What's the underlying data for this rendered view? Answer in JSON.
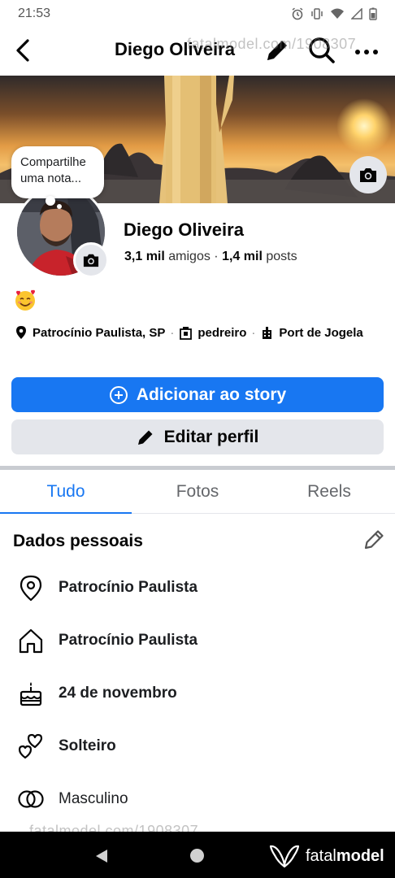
{
  "status_bar": {
    "time": "21:53"
  },
  "nav": {
    "title": "Diego Oliveira"
  },
  "watermark": {
    "text": "fatalmodel.com/1908307"
  },
  "note": {
    "text": "Compartilhe uma nota..."
  },
  "profile": {
    "name": "Diego Oliveira",
    "friends_count": "3,1 mil",
    "friends_label": "amigos",
    "separator": "·",
    "posts_count": "1,4 mil",
    "posts_label": "posts",
    "emoji": "🥰"
  },
  "details": {
    "location": "Patrocínio Paulista, SP",
    "job": "pedreiro",
    "workplace": "Port de Jogela"
  },
  "buttons": {
    "add_story": "Adicionar ao story",
    "edit_profile": "Editar perfil"
  },
  "tabs": [
    {
      "label": "Tudo",
      "active": true
    },
    {
      "label": "Fotos",
      "active": false
    },
    {
      "label": "Reels",
      "active": false
    }
  ],
  "personal": {
    "title": "Dados pessoais",
    "items": [
      {
        "icon": "location-pin-icon",
        "text": "Patrocínio Paulista"
      },
      {
        "icon": "home-icon",
        "text": "Patrocínio Paulista"
      },
      {
        "icon": "birthday-cake-icon",
        "text": "24 de novembro"
      },
      {
        "icon": "hearts-icon",
        "text": "Solteiro"
      },
      {
        "icon": "gender-rings-icon",
        "text": "Masculino"
      }
    ]
  },
  "brand": {
    "name_light": "fatal",
    "name_bold": "model"
  },
  "colors": {
    "accent": "#1877f2",
    "button_gray": "#e4e6eb",
    "text": "#050505"
  }
}
